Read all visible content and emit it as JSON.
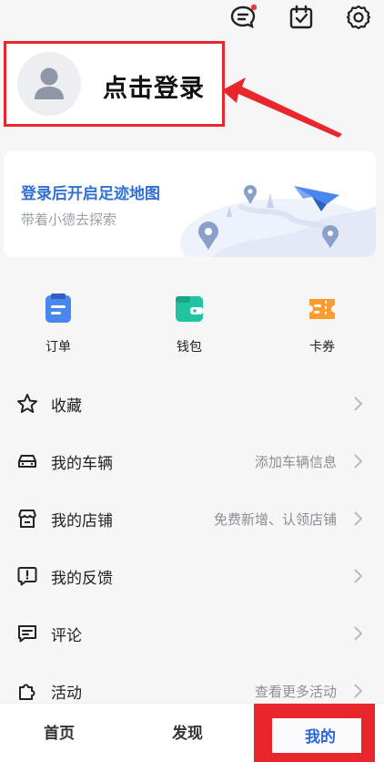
{
  "header": {
    "icons": [
      "message-icon",
      "calendar-check-icon",
      "settings-icon"
    ]
  },
  "login": {
    "label": "点击登录"
  },
  "footprint": {
    "title": "登录后开启足迹地图",
    "subtitle": "带着小德去探索"
  },
  "quick_actions": [
    {
      "label": "订单",
      "icon": "order-icon",
      "color": "#4a86f0"
    },
    {
      "label": "钱包",
      "icon": "wallet-icon",
      "color": "#22c3a0"
    },
    {
      "label": "卡券",
      "icon": "coupon-icon",
      "color": "#ff9a2e"
    }
  ],
  "menu": [
    {
      "label": "收藏",
      "hint": "",
      "icon": "star-icon"
    },
    {
      "label": "我的车辆",
      "hint": "添加车辆信息",
      "icon": "car-icon"
    },
    {
      "label": "我的店铺",
      "hint": "免费新增、认领店铺",
      "icon": "store-icon"
    },
    {
      "label": "我的反馈",
      "hint": "",
      "icon": "feedback-icon"
    },
    {
      "label": "评论",
      "hint": "",
      "icon": "comment-icon"
    },
    {
      "label": "活动",
      "hint": "查看更多活动",
      "icon": "puzzle-icon"
    }
  ],
  "tabbar": {
    "home": "首页",
    "discover": "发现",
    "me": "我的"
  },
  "colors": {
    "accent": "#2f6fd6",
    "highlight": "#e8262c"
  }
}
